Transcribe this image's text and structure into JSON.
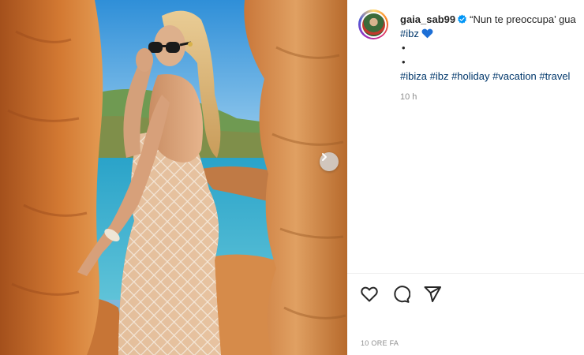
{
  "post": {
    "username": "gaia_sab99",
    "caption_text": "“Nun te preoccupa’ gua",
    "caption_hashtag": "#ibz",
    "caption_heart": "💙",
    "dot_lines": [
      "•",
      "•"
    ],
    "hashtags": [
      "#ibiza",
      "#ibz",
      "#holiday",
      "#vacation",
      "#travel"
    ],
    "comment_time": "10 h",
    "footer_time": "10 ORE FA"
  },
  "icons": {
    "verified": "verified-badge-icon",
    "next": "chevron-right-icon",
    "like": "heart-icon",
    "comment": "comment-icon",
    "share": "paper-plane-icon"
  },
  "colors": {
    "verified": "#0095f6",
    "hashtag": "#00376b",
    "muted": "#8e8e8e",
    "heart_emoji": "#1d6fd6"
  }
}
